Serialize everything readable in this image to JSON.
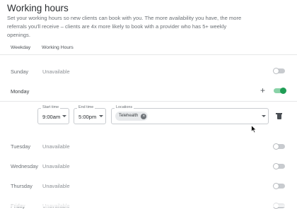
{
  "page": {
    "title": "Working hours",
    "subtitle": "Set your working hours so new clients can book with you. The more availability you have, the more referrals you'll receive – clients are 4x more likely to book with a provider who has 5+ weekly openings."
  },
  "table": {
    "columns": [
      "Weekday",
      "Working Hours"
    ]
  },
  "days": [
    {
      "name": "Sunday",
      "status": "Unavailable",
      "enabled": false
    },
    {
      "name": "Monday",
      "status": "",
      "enabled": true
    },
    {
      "name": "Tuesday",
      "status": "Unavailable",
      "enabled": false
    },
    {
      "name": "Wednesday",
      "status": "Unavailable",
      "enabled": false
    },
    {
      "name": "Thursday",
      "status": "Unavailable",
      "enabled": false
    },
    {
      "name": "Friday",
      "status": "Unavailable",
      "enabled": false
    }
  ],
  "monday_slot": {
    "start_label": "Start time",
    "start_value": "9:00am",
    "end_label": "End time",
    "end_value": "5:00pm",
    "locations_label": "Locations",
    "location_chip": "Telehealth"
  },
  "colors": {
    "accent_green": "#1f9d55",
    "toggle_off": "#c8cbcf"
  },
  "icons": {
    "add": "plus-icon",
    "delete": "trash-icon",
    "remove_chip": "close-circle-icon",
    "dropdown": "chevron-down-icon"
  }
}
